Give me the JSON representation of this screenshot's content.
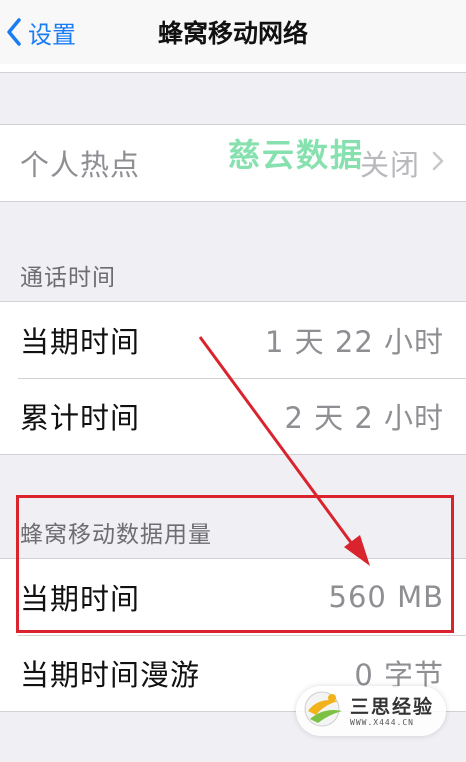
{
  "nav": {
    "back_label": "设置",
    "title": "蜂窝移动网络"
  },
  "hotspot": {
    "label": "个人热点",
    "value": "关闭"
  },
  "call_time": {
    "header": "通话时间",
    "rows": [
      {
        "label": "当期时间",
        "value": "1 天 22 小时"
      },
      {
        "label": "累计时间",
        "value": "2 天 2 小时"
      }
    ]
  },
  "cellular_data": {
    "header": "蜂窝移动数据用量",
    "rows": [
      {
        "label": "当期时间",
        "value": "560 MB"
      },
      {
        "label": "当期时间漫游",
        "value": "0 字节"
      }
    ]
  },
  "watermarks": {
    "top_text": "慈云数据",
    "logo_main": "三思经验",
    "logo_sub": "WWW.X444.CN"
  },
  "colors": {
    "accent": "#1a7cf5",
    "highlight_box": "#d9232d",
    "background": "#efeff4",
    "watermark_green": "#22c86e"
  }
}
